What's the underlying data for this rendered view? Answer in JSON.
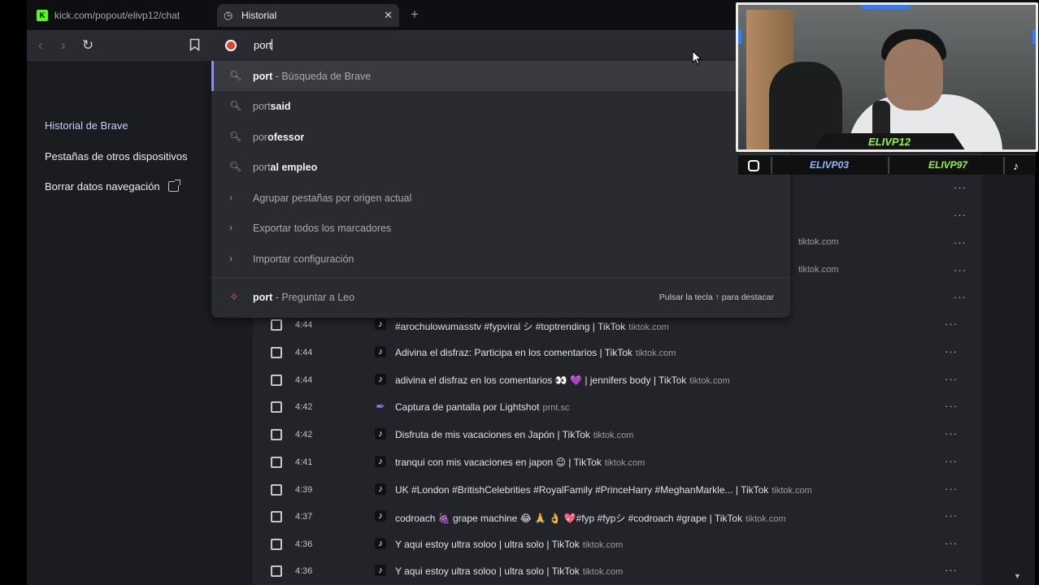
{
  "tabs": [
    {
      "label": "kick.com/popout/elivp12/chat",
      "icon": "kick-icon"
    },
    {
      "label": "Historial",
      "icon": "history-icon",
      "close": "✕"
    }
  ],
  "new_tab": "+",
  "omnibox": {
    "value": "port"
  },
  "suggestions": [
    {
      "icon": "search-icon",
      "bold": "port",
      "rest": " - Búsqueda de Brave",
      "html_parts": [
        "port",
        " - Búsqueda de Brave"
      ]
    },
    {
      "icon": "search-icon",
      "prefix": "port",
      "bold": "said"
    },
    {
      "icon": "search-icon",
      "prefix": "por",
      "bold": "ofessor"
    },
    {
      "icon": "search-icon",
      "prefix": "port",
      "bold": "al empleo"
    },
    {
      "icon": "chevron-right-icon",
      "text": "Agrupar pestañas por origen actual"
    },
    {
      "icon": "chevron-right-icon",
      "text": "Exportar todos los marcadores"
    },
    {
      "icon": "chevron-right-icon",
      "text": "Importar configuración"
    },
    {
      "icon": "leo-icon",
      "bold": "port",
      "rest": " - Preguntar a Leo",
      "hint": "Pulsar la tecla ↑ para destacar"
    }
  ],
  "sidebar": {
    "items": [
      {
        "label": "Historial de Brave"
      },
      {
        "label": "Pestañas de otros dispositivos"
      },
      {
        "label": "Borrar datos navegación"
      }
    ]
  },
  "history_partial": [
    {
      "domain": "tiktok.com"
    },
    {
      "domain": "tiktok.com"
    }
  ],
  "history": [
    {
      "time": "4:44",
      "icon": "tiktok-icon",
      "title": "#arochulowumasstv #fypviral シ #toptrending | TikTok",
      "domain": "tiktok.com"
    },
    {
      "time": "4:44",
      "icon": "tiktok-icon",
      "title": "Adivina el disfraz: Participa en los comentarios | TikTok",
      "domain": "tiktok.com"
    },
    {
      "time": "4:44",
      "icon": "tiktok-icon",
      "title": "adivina el disfraz en los comentarios 👀 💜 | jennifers body | TikTok",
      "domain": "tiktok.com"
    },
    {
      "time": "4:42",
      "icon": "feather-icon",
      "title": "Captura de pantalla por Lightshot",
      "domain": "prnt.sc"
    },
    {
      "time": "4:42",
      "icon": "tiktok-icon",
      "title": "Disfruta de mis vacaciones en Japón | TikTok",
      "domain": "tiktok.com"
    },
    {
      "time": "4:41",
      "icon": "tiktok-icon",
      "title": "tranqui con mis vacaciones en japon 😉 | TikTok",
      "domain": "tiktok.com"
    },
    {
      "time": "4:39",
      "icon": "tiktok-icon",
      "title": "UK #London #BritishCelebrities #RoyalFamily #PrinceHarry #MeghanMarkle... | TikTok",
      "domain": "tiktok.com"
    },
    {
      "time": "4:37",
      "icon": "tiktok-icon",
      "title": "codroach 🍇 grape machine 😂 🙏 👌 💖#fyp #fypシ #codroach #grape | TikTok",
      "domain": "tiktok.com"
    },
    {
      "time": "4:36",
      "icon": "tiktok-icon",
      "title": "Y aqui estoy ultra soloo | ultra solo | TikTok",
      "domain": "tiktok.com"
    },
    {
      "time": "4:36",
      "icon": "tiktok-icon",
      "title": "Y aqui estoy ultra soloo | ultra solo | TikTok",
      "domain": "tiktok.com"
    }
  ],
  "more_glyph": "···",
  "webcam": {
    "name": "ELIVP12",
    "socials": [
      "ELIVP03",
      "ELIVP97"
    ]
  },
  "colors": {
    "accent": "#8a8cf0",
    "kick": "#53fc18",
    "cam_text": "#9cf03a"
  }
}
